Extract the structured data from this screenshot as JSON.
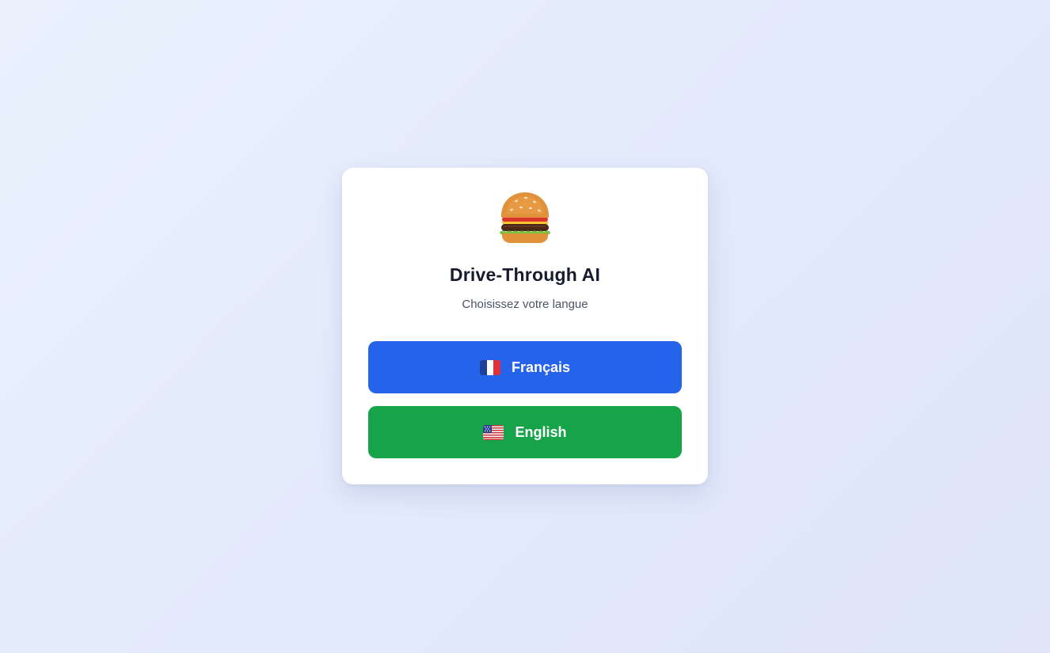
{
  "app": {
    "title": "Drive-Through AI",
    "subtitle": "Choisissez votre langue",
    "logo_icon": "hamburger-icon"
  },
  "languages": [
    {
      "label": "Français",
      "flag_icon": "france-flag-icon",
      "color": "#2563eb"
    },
    {
      "label": "English",
      "flag_icon": "us-flag-icon",
      "color": "#16a34a"
    }
  ],
  "colors": {
    "title": "#161b2e",
    "subtitle": "#4b5365",
    "card": "#ffffff"
  }
}
